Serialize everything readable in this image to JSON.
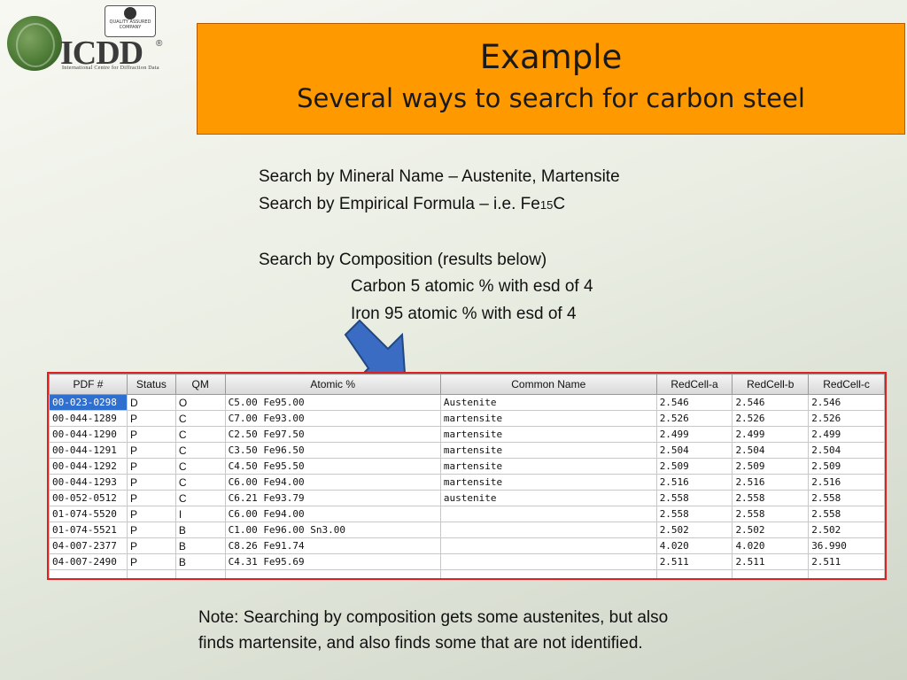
{
  "logo": {
    "brand": "ICDD",
    "registered": "®",
    "subtitle": "International Centre for Diffraction Data",
    "badge_text": "QUALITY ASSURED COMPANY"
  },
  "title": {
    "line1": "Example",
    "line2": "Several ways to search for carbon steel"
  },
  "body": {
    "line1": "Search by Mineral Name – Austenite, Martensite",
    "line2_prefix": "Search by Empirical Formula – i.e. Fe",
    "line2_sub": "15",
    "line2_suffix": "C",
    "line3": "Search by Composition (results below)",
    "line4": "Carbon 5 atomic % with esd of 4",
    "line5": "Iron 95 atomic % with esd of 4"
  },
  "table": {
    "headers": [
      "PDF #",
      "Status",
      "QM",
      "Atomic %",
      "Common Name",
      "RedCell-a",
      "RedCell-b",
      "RedCell-c"
    ],
    "rows": [
      [
        "00-023-0298",
        "D",
        "O",
        "C5.00 Fe95.00",
        "Austenite",
        "2.546",
        "2.546",
        "2.546"
      ],
      [
        "00-044-1289",
        "P",
        "C",
        "C7.00 Fe93.00",
        "martensite",
        "2.526",
        "2.526",
        "2.526"
      ],
      [
        "00-044-1290",
        "P",
        "C",
        "C2.50 Fe97.50",
        "martensite",
        "2.499",
        "2.499",
        "2.499"
      ],
      [
        "00-044-1291",
        "P",
        "C",
        "C3.50 Fe96.50",
        "martensite",
        "2.504",
        "2.504",
        "2.504"
      ],
      [
        "00-044-1292",
        "P",
        "C",
        "C4.50 Fe95.50",
        "martensite",
        "2.509",
        "2.509",
        "2.509"
      ],
      [
        "00-044-1293",
        "P",
        "C",
        "C6.00 Fe94.00",
        "martensite",
        "2.516",
        "2.516",
        "2.516"
      ],
      [
        "00-052-0512",
        "P",
        "C",
        "C6.21 Fe93.79",
        "austenite",
        "2.558",
        "2.558",
        "2.558"
      ],
      [
        "01-074-5520",
        "P",
        "I",
        "C6.00 Fe94.00",
        "",
        "2.558",
        "2.558",
        "2.558"
      ],
      [
        "01-074-5521",
        "P",
        "B",
        "C1.00 Fe96.00 Sn3.00",
        "",
        "2.502",
        "2.502",
        "2.502"
      ],
      [
        "04-007-2377",
        "P",
        "B",
        "C8.26 Fe91.74",
        "",
        "4.020",
        "4.020",
        "36.990"
      ],
      [
        "04-007-2490",
        "P",
        "B",
        "C4.31 Fe95.69",
        "",
        "2.511",
        "2.511",
        "2.511"
      ]
    ]
  },
  "note": {
    "line1": "Note: Searching by composition gets some austenites, but also",
    "line2": "finds martensite, and also finds some that are not identified."
  },
  "colors": {
    "title_bg": "#ff9900",
    "table_border": "#e02020",
    "selection": "#2f6fd0",
    "arrow": "#3b6cc4"
  }
}
